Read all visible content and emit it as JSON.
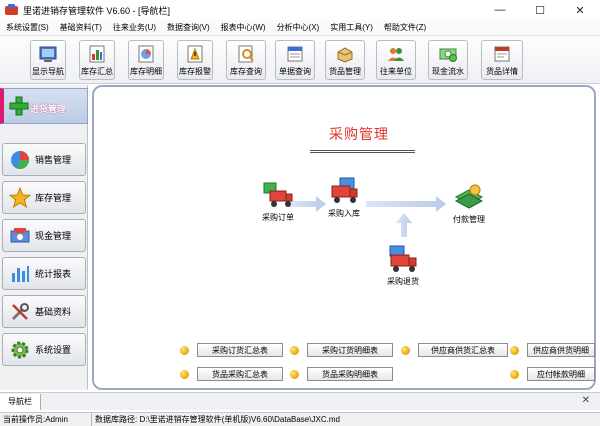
{
  "window": {
    "title": "里诺进销存管理软件 V6.60 - [导航栏]",
    "minimize": "—",
    "maximize": "☐",
    "close": "✕"
  },
  "menu": [
    "系统设置(S)",
    "基础资料(T)",
    "往来业务(U)",
    "数据查询(V)",
    "报表中心(W)",
    "分析中心(X)",
    "实用工具(Y)",
    "帮助文件(Z)"
  ],
  "toolbar": [
    {
      "label": "显示导航",
      "icon": "navigation-icon"
    },
    {
      "label": "库存汇总",
      "icon": "stock-summary-icon"
    },
    {
      "label": "库存明细",
      "icon": "stock-detail-icon"
    },
    {
      "label": "库存报警",
      "icon": "stock-alarm-icon"
    },
    {
      "label": "库存查询",
      "icon": "stock-query-icon"
    },
    {
      "label": "单据查询",
      "icon": "document-query-icon"
    },
    {
      "label": "货品管理",
      "icon": "goods-icon"
    },
    {
      "label": "往来单位",
      "icon": "contacts-icon"
    },
    {
      "label": "现金流水",
      "icon": "cash-flow-icon"
    },
    {
      "label": "货品详情",
      "icon": "goods-detail-icon"
    }
  ],
  "sidebar": {
    "active": {
      "label": "进货管理",
      "icon": "plus-icon"
    },
    "items": [
      {
        "label": "销售管理",
        "icon": "pie-chart-icon"
      },
      {
        "label": "库存管理",
        "icon": "star-icon"
      },
      {
        "label": "现金管理",
        "icon": "cash-icon"
      },
      {
        "label": "统计报表",
        "icon": "bar-chart-icon"
      },
      {
        "label": "基础资料",
        "icon": "tools-icon"
      },
      {
        "label": "系统设置",
        "icon": "gear-icon"
      }
    ]
  },
  "module": {
    "title": "采购管理"
  },
  "flow": {
    "order": "采购订单",
    "inbound": "采购入库",
    "payment": "付款管理",
    "returns": "采购退货"
  },
  "reports": [
    {
      "label": "采购订货汇总表"
    },
    {
      "label": "采购订货明细表"
    },
    {
      "label": "供应商供货汇总表"
    },
    {
      "label": "供应商供货明细"
    },
    {
      "label": "货品采购汇总表"
    },
    {
      "label": "货品采购明细表"
    },
    {
      "label": "应付帐款明细"
    }
  ],
  "tabs": {
    "active": "导航栏",
    "close": "✕"
  },
  "status": {
    "user": "当前操作员:Admin",
    "db_path": "数据库路径: D:\\里诺进销存管理软件(单机版)V6.60\\DataBase\\JXC.md"
  },
  "colors": {
    "accent_red": "#e3312b",
    "active_magenta": "#d81b6e",
    "frame_blue": "#9aa8c6"
  }
}
